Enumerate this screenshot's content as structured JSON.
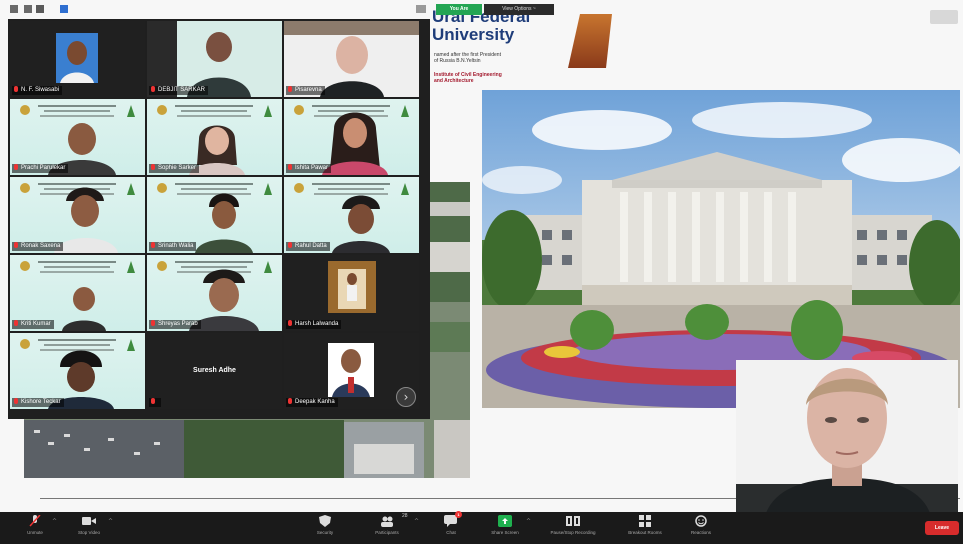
{
  "window": {
    "app": "Zoom",
    "top_bar": {
      "viewing_label": "You Are",
      "view_options_label": "View Options ~"
    }
  },
  "slide": {
    "university_title": "Ural Federal\nUniversity",
    "university_subtitle": "named after the first President\nof Russia B.N.Yeltsin",
    "institute": "Institute of Civil Engineering\nand Architecture",
    "aerial_caption": "",
    "corner_label": "",
    "colors": {
      "title": "#1f3d7a",
      "institute": "#a3192d"
    }
  },
  "gallery": {
    "tiles": [
      {
        "name": "N. F. Siwasabi",
        "type": "photo"
      },
      {
        "name": "DEBJIT SARKAR",
        "type": "video"
      },
      {
        "name": "Pisarevna",
        "type": "video"
      },
      {
        "name": "Prachi Parulekar",
        "type": "video"
      },
      {
        "name": "Sophie Sarker",
        "type": "video"
      },
      {
        "name": "Ishita Pawar",
        "type": "video"
      },
      {
        "name": "Ronak Saxena",
        "type": "video"
      },
      {
        "name": "Srinath Walia",
        "type": "video"
      },
      {
        "name": "Rahul Datta",
        "type": "video"
      },
      {
        "name": "Kriti Kumar",
        "type": "video"
      },
      {
        "name": "Shreyas Parab",
        "type": "video"
      },
      {
        "name": "Harsh Lalwanda",
        "type": "photo"
      },
      {
        "name": "Kishore Teckar",
        "type": "video"
      },
      {
        "name": "Suresh Adhe",
        "type": "name-only"
      },
      {
        "name": "Deepak Kanha",
        "type": "photo"
      }
    ],
    "next_page_icon": "chevron-right-icon"
  },
  "toolbar": {
    "items": [
      {
        "label": "Unmute",
        "icon": "mic-muted-icon"
      },
      {
        "label": "Stop Video",
        "icon": "video-camera-icon"
      },
      {
        "label": "Security",
        "icon": "shield-icon"
      },
      {
        "label": "Participants",
        "icon": "participants-icon",
        "count": "28"
      },
      {
        "label": "Chat",
        "icon": "chat-icon",
        "badge": "1"
      },
      {
        "label": "Share Screen",
        "icon": "share-screen-icon"
      },
      {
        "label": "Pause/Stop Recording",
        "icon": "recording-icon"
      },
      {
        "label": "Breakout Rooms",
        "icon": "breakout-rooms-icon"
      },
      {
        "label": "Reactions",
        "icon": "reactions-icon"
      }
    ],
    "leave_label": "Leave",
    "colors": {
      "share": "#1fb14f",
      "leave": "#d72c2c"
    }
  }
}
